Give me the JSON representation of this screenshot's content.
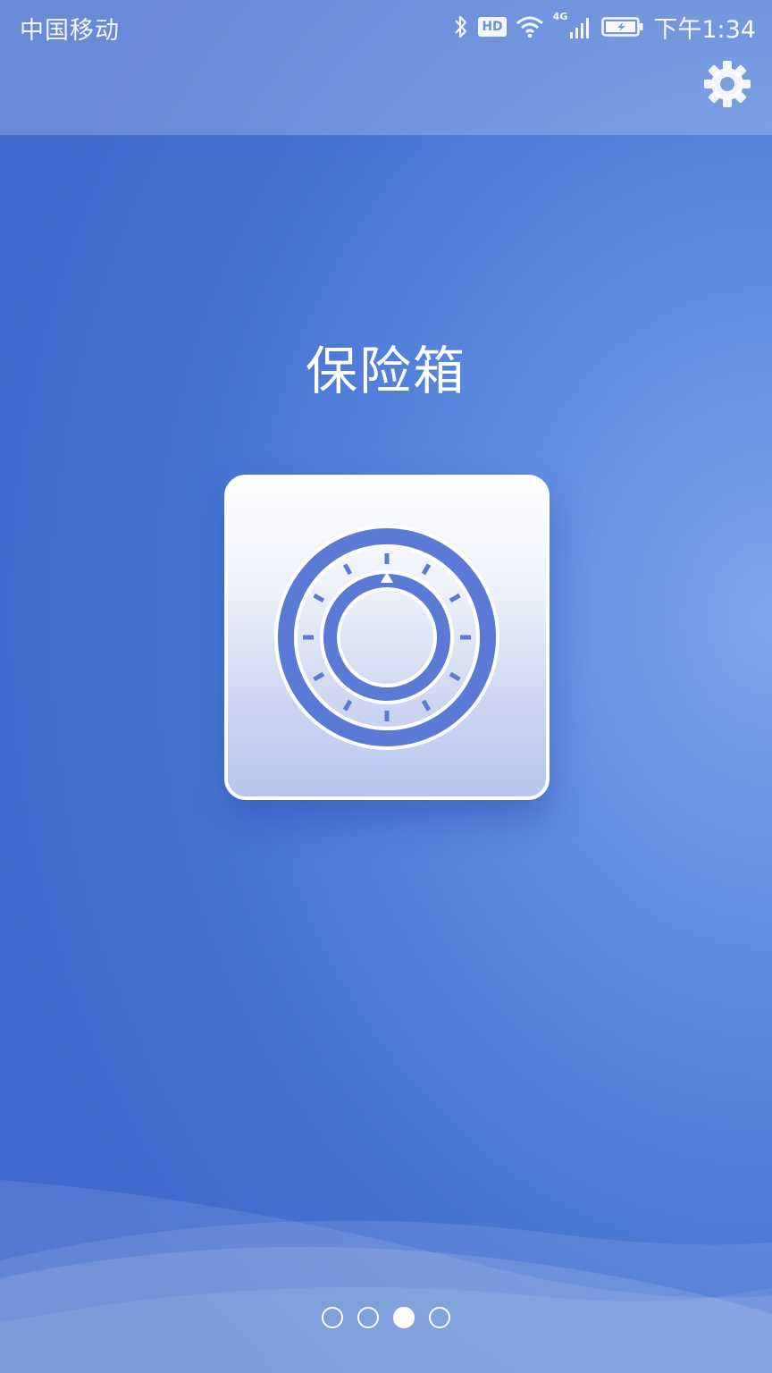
{
  "status_bar": {
    "carrier": "中国移动",
    "hd_label": "HD",
    "network_label": "4G",
    "time": "下午1:34"
  },
  "header": {
    "settings_icon": "gear-icon"
  },
  "main": {
    "title": "保险箱",
    "feature_icon": "safe-dial-icon"
  },
  "pager": {
    "total": 4,
    "active_index": 2
  },
  "colors": {
    "background": "#4a78d6",
    "dial_blue": "#5b7ad6",
    "white": "#ffffff"
  }
}
